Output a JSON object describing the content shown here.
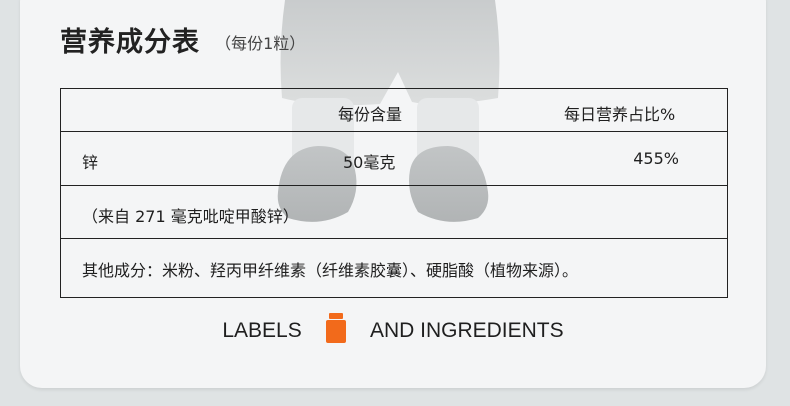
{
  "header": {
    "title": "营养成分表",
    "subtitle": "（每份1粒）"
  },
  "table": {
    "col_serving": "每份含量",
    "col_daily": "每日营养占比%",
    "rows": [
      {
        "name": "锌",
        "amount": "50毫克",
        "daily": "455%"
      }
    ],
    "source_note": "（来自 271 毫克吡啶甲酸锌）",
    "other_ingredients": "其他成分：米粉、羟丙甲纤维素（纤维素胶囊）、硬脂酸（植物来源）。"
  },
  "footer": {
    "left": "LABELS",
    "right": "AND INGREDIENTS",
    "bottle_icon": "supplement-bottle-icon",
    "bottle_color": "#f26a1b"
  },
  "colors": {
    "background": "#dfe3e4",
    "card": "#f4f5f6",
    "border": "#222222",
    "accent": "#f26a1b"
  }
}
